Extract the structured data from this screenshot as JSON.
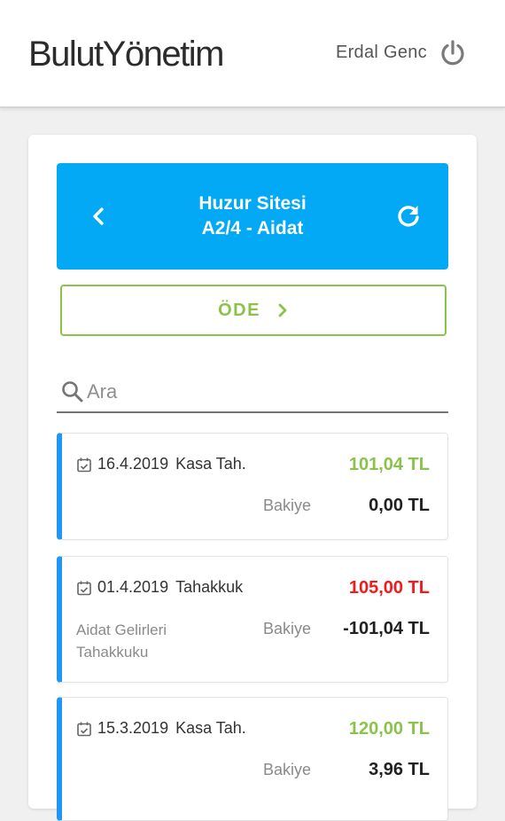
{
  "header": {
    "brand": "BulutYönetim",
    "user_name": "Erdal Genc",
    "power_icon": "power-icon"
  },
  "panel": {
    "title_line1": "Huzur Sitesi",
    "title_line2": "A2/4 - Aidat",
    "back_icon": "chevron-left-icon",
    "refresh_icon": "refresh-icon",
    "brand_color": "#03a9f4"
  },
  "pay": {
    "label": "ÖDE",
    "color": "#8bc34a"
  },
  "search": {
    "placeholder": "Ara",
    "value": ""
  },
  "transactions": [
    {
      "date": "16.4.2019",
      "type": "Kasa Tah.",
      "amount": "101,04 TL",
      "amount_color": "#8bc34a",
      "description": "",
      "balance_label": "Bakiye",
      "balance": "0,00 TL"
    },
    {
      "date": "01.4.2019",
      "type": "Tahakkuk",
      "amount": "105,00 TL",
      "amount_color": "#f41a1a",
      "description": "Aidat Gelirleri Tahakkuku",
      "balance_label": "Bakiye",
      "balance": "-101,04 TL"
    },
    {
      "date": "15.3.2019",
      "type": "Kasa Tah.",
      "amount": "120,00 TL",
      "amount_color": "#8bc34a",
      "description": "",
      "balance_label": "Bakiye",
      "balance": "3,96 TL"
    }
  ]
}
